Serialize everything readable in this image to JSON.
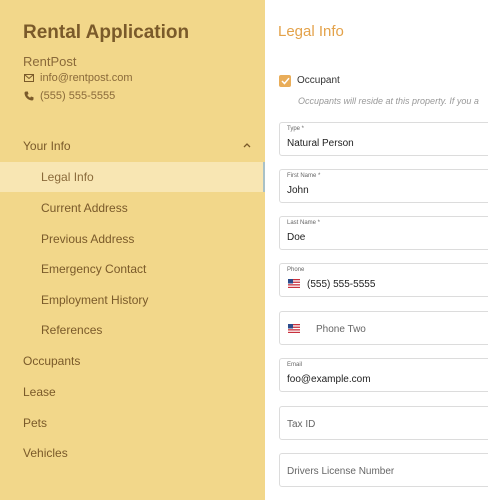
{
  "sidebar": {
    "title": "Rental Application",
    "company": "RentPost",
    "email": "info@rentpost.com",
    "phone": "(555) 555-5555",
    "nav": {
      "your_info": "Your Info",
      "legal_info": "Legal Info",
      "current_address": "Current Address",
      "previous_address": "Previous Address",
      "emergency_contact": "Emergency Contact",
      "employment_history": "Employment History",
      "references": "References",
      "occupants": "Occupants",
      "lease": "Lease",
      "pets": "Pets",
      "vehicles": "Vehicles"
    }
  },
  "main": {
    "title": "Legal Info",
    "occupant_checkbox": {
      "label": "Occupant",
      "checked": true
    },
    "occupant_helper": "Occupants will reside at this property. If you a",
    "fields": {
      "type": {
        "label": "Type *",
        "value": "Natural Person"
      },
      "first_name": {
        "label": "First Name *",
        "value": "John"
      },
      "last_name": {
        "label": "Last Name *",
        "value": "Doe"
      },
      "phone": {
        "label": "Phone",
        "value": "(555) 555-5555"
      },
      "phone_two": {
        "placeholder": "Phone Two"
      },
      "email": {
        "label": "Email",
        "value": "foo@example.com"
      },
      "tax_id": {
        "placeholder": "Tax ID"
      },
      "drivers_license": {
        "placeholder": "Drivers License Number"
      }
    }
  },
  "colors": {
    "sidebar_bg": "#f2d78a",
    "active_bg": "#f8e6b3",
    "accent": "#e3a24a"
  }
}
